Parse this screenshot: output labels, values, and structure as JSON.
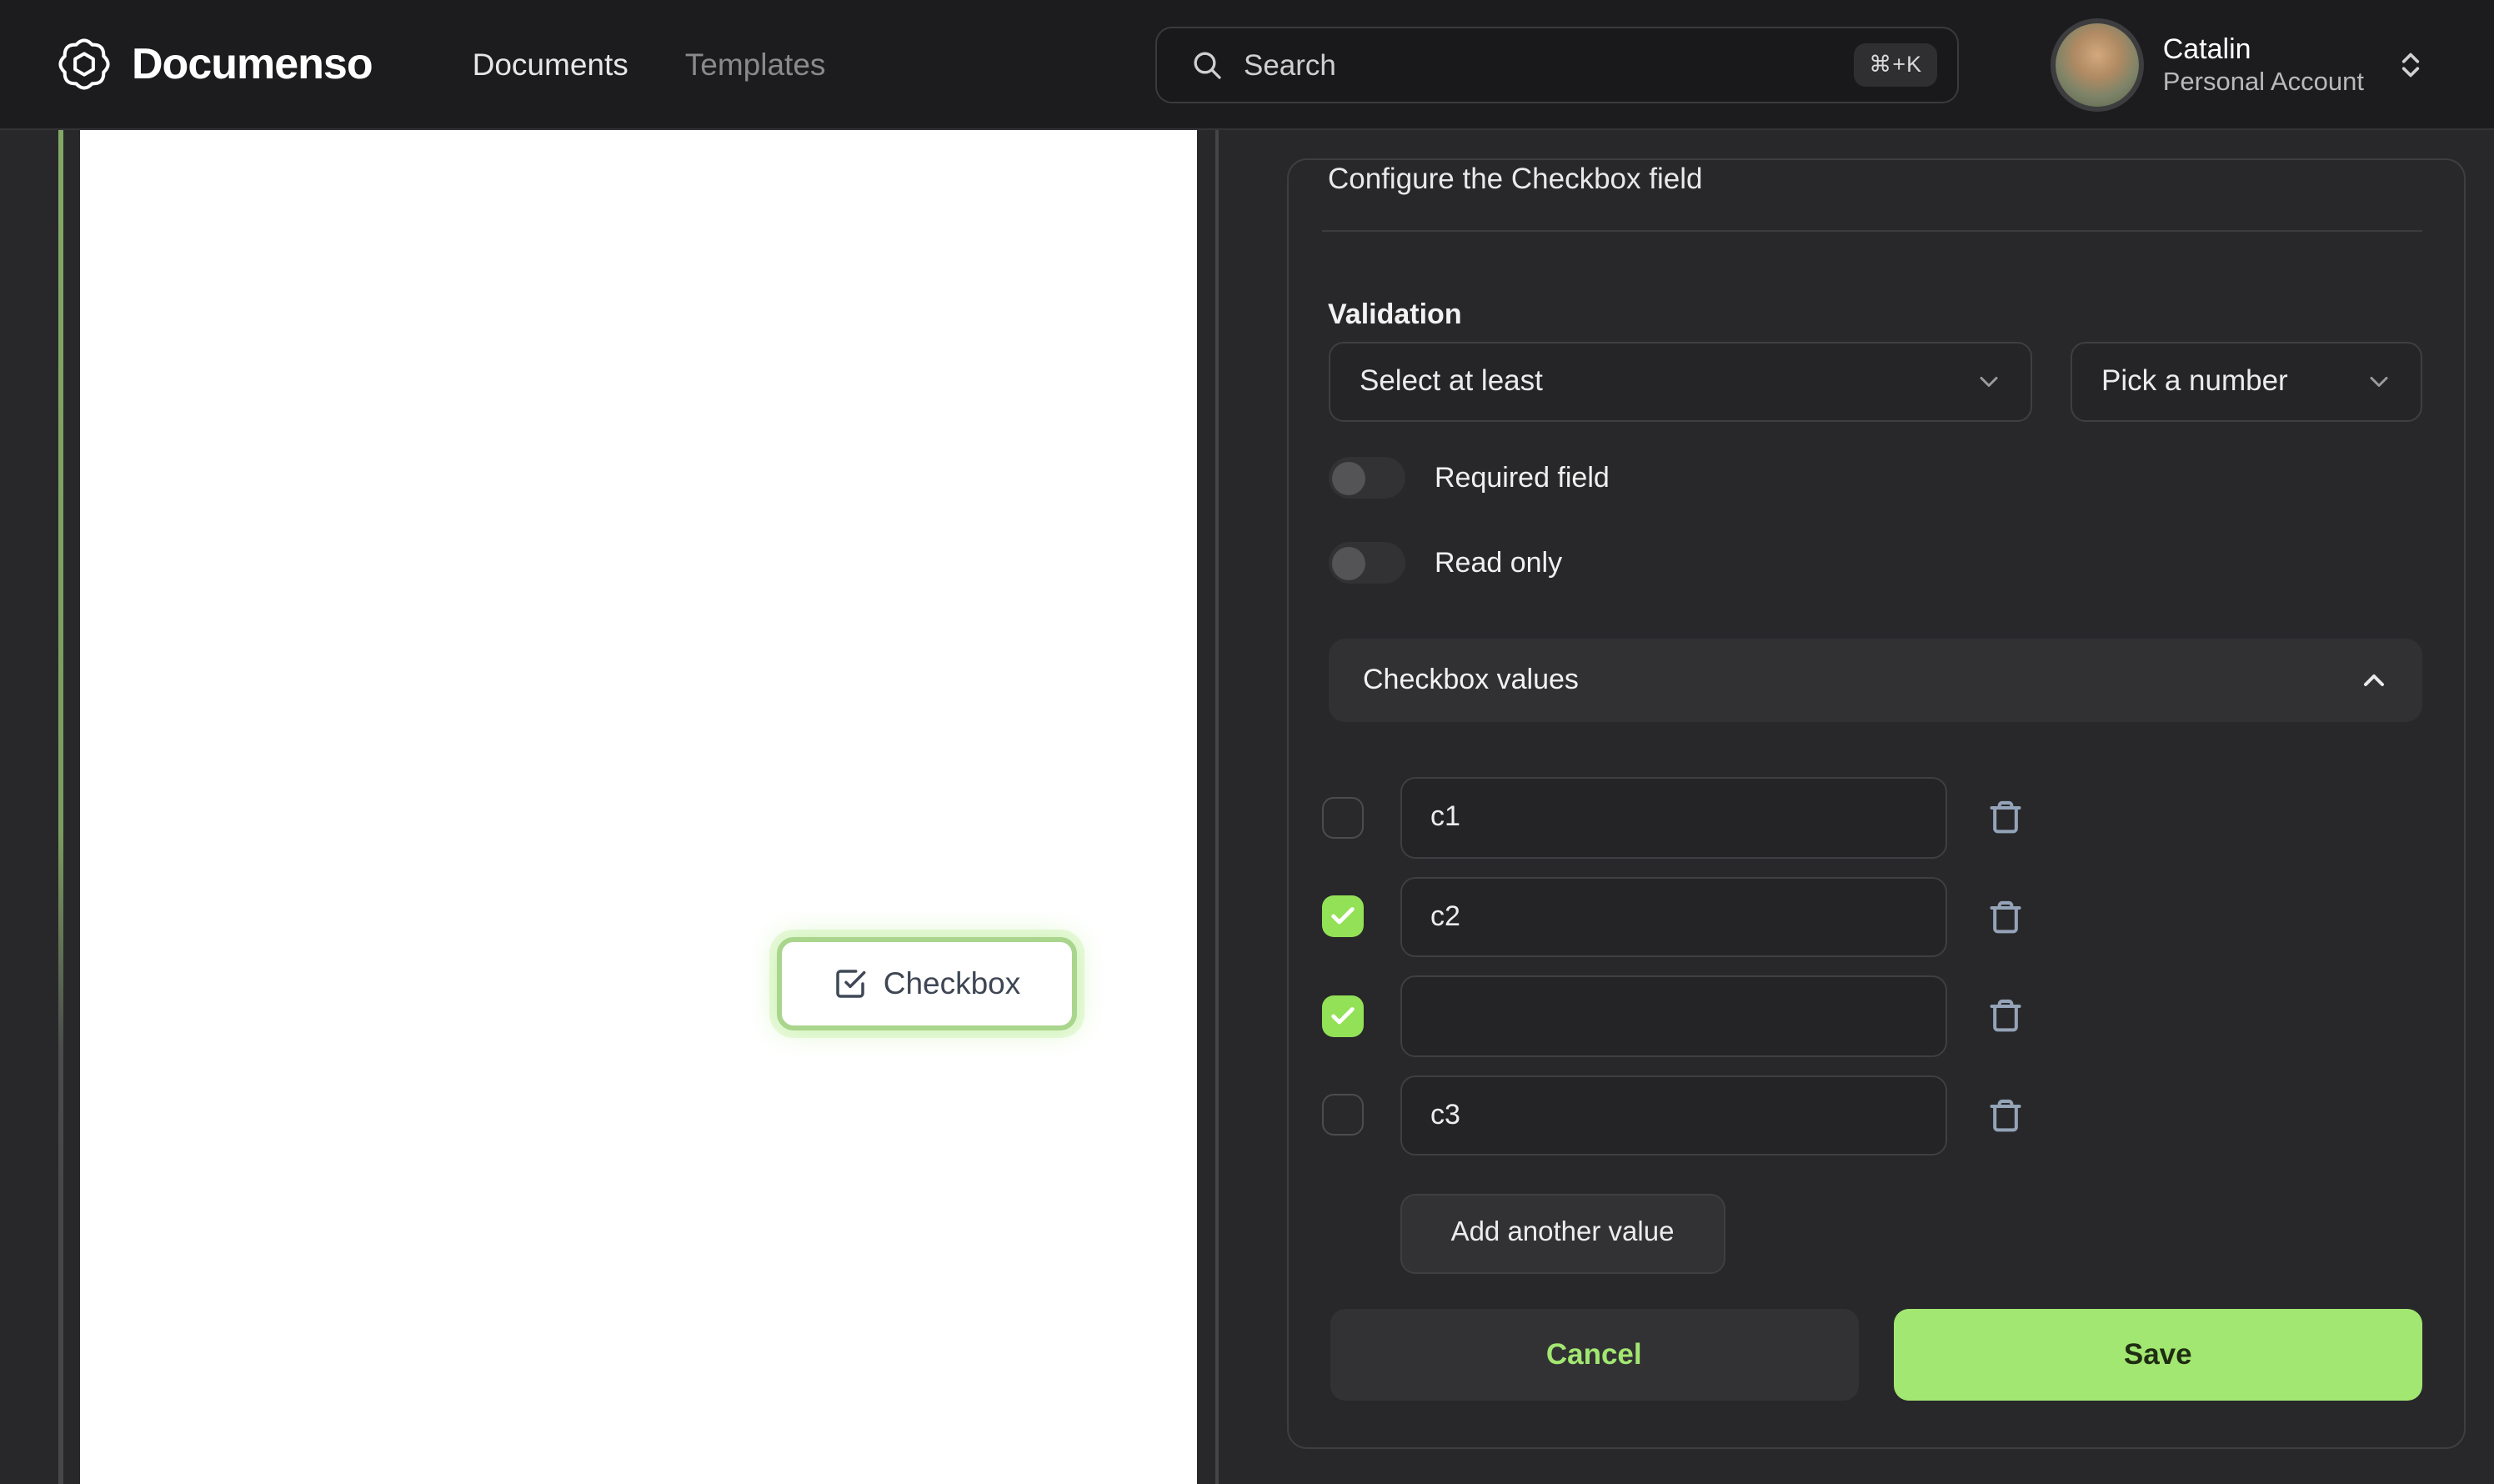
{
  "header": {
    "brand": "Documenso",
    "nav": {
      "documents": "Documents",
      "templates": "Templates"
    },
    "search": {
      "placeholder": "Search",
      "shortcut": "⌘+K"
    },
    "user": {
      "name": "Catalin",
      "account": "Personal Account"
    }
  },
  "document": {
    "field": {
      "label": "Checkbox",
      "type": "checkbox"
    }
  },
  "panel": {
    "title": "Configure the Checkbox field",
    "validation_label": "Validation",
    "rule_select": {
      "value": "Select at least"
    },
    "number_select": {
      "value": "Pick a number"
    },
    "required_toggle": {
      "label": "Required field",
      "on": false
    },
    "readonly_toggle": {
      "label": "Read only",
      "on": false
    },
    "values_header": {
      "label": "Checkbox values",
      "expanded": true
    },
    "values": [
      {
        "value": "c1",
        "checked": false
      },
      {
        "value": "c2",
        "checked": true
      },
      {
        "value": "",
        "checked": true
      },
      {
        "value": "c3",
        "checked": false
      }
    ],
    "add_button": "Add another value",
    "cancel_button": "Cancel",
    "save_button": "Save"
  },
  "colors": {
    "accent_green": "#a2e771",
    "checkbox_green": "#93e156",
    "field_border_green": "#a9d58d",
    "trash_icon": "#94a3b8",
    "accent_line_green": "#7a9c5f"
  }
}
